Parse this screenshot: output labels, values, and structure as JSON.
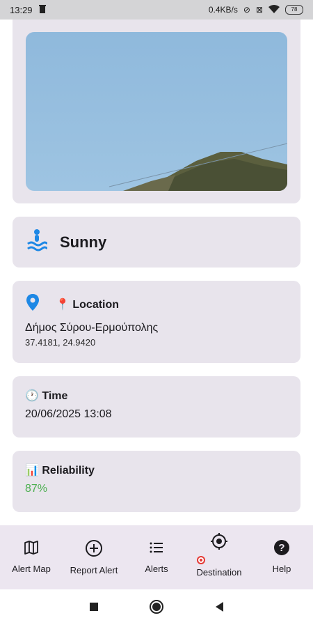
{
  "status_bar": {
    "time": "13:29",
    "net_speed": "0.4KB/s",
    "battery": "78"
  },
  "weather": {
    "title": "Sunny",
    "icon": "weather-wave-person-icon"
  },
  "location": {
    "heading": "📍 Location",
    "name": "Δήμος Σύρου-Ερμούπολης",
    "coords": "37.4181, 24.9420"
  },
  "time_card": {
    "heading": "🕐 Time",
    "value": "20/06/2025 13:08"
  },
  "reliability": {
    "heading": "📊 Reliability",
    "value": "87%",
    "value_color": "#4caf50"
  },
  "bottom_nav": {
    "items": [
      {
        "label": "Alert Map",
        "icon": "map-icon"
      },
      {
        "label": "Report Alert",
        "icon": "add-circle-icon"
      },
      {
        "label": "Alerts",
        "icon": "list-icon"
      },
      {
        "label": "Destination",
        "icon": "target-icon",
        "label_prefix_icon": "dart-target-icon"
      },
      {
        "label": "Help",
        "icon": "help-icon"
      }
    ]
  },
  "colors": {
    "card_bg": "#e8e4ec",
    "nav_bg": "#ece6f0",
    "accent_blue": "#1e88e5"
  }
}
